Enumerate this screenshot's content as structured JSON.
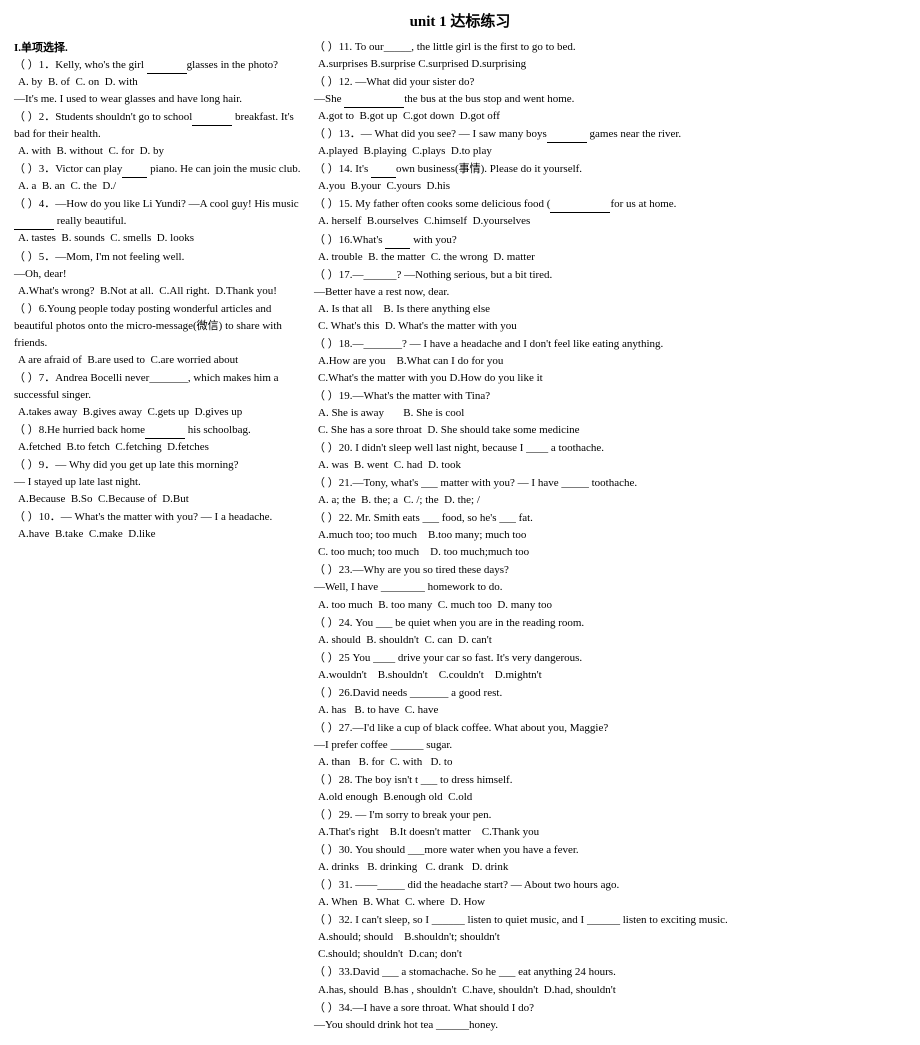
{
  "title": "unit 1  达标练习",
  "left_section": {
    "header": "I.单项选择.",
    "items": [
      {
        "id": "1",
        "question": "（  ）1．Kelly, who's the girl ____glasses in the photo?",
        "options": "A. by  B. of  C. on  D. with"
      },
      {
        "id": "1b",
        "question": "—It's me. I used to wear glasses and have long hair."
      },
      {
        "id": "2",
        "question": "（  ）2．Students shouldn't go to school____ breakfast. It's bad for their health.",
        "options": "A. with  B. without  C. for  D. by"
      },
      {
        "id": "3",
        "question": "（  ）3．Victor can play____ piano. He can join the music club.",
        "options": "A. a  B. an  C. the  D./"
      },
      {
        "id": "4",
        "question": "（  ）4．—How do you like Li Yundi?  —A cool guy! His music ______ really beautiful.",
        "options": "A. tastes  B. sounds  C. smells  D. looks"
      },
      {
        "id": "5",
        "question": "（  ）5．—Mom, I'm not feeling well.",
        "sub": "—Oh, dear!",
        "options": "A.What's wrong?  B.Not at all.  C.All right.  D.Thank you!"
      },
      {
        "id": "6",
        "question": "（  ）6.Young people today posting wonderful articles and beautiful photos onto the micro-message(微信) to share with friends.",
        "options": "A are afraid of  B.are used to  C.are worried about"
      },
      {
        "id": "7",
        "question": "（  ）7．Andrea Bocelli never_______, which makes him a successful singer.",
        "options": "A.takes away  B.gives away  C.gets up  D.gives up"
      },
      {
        "id": "8",
        "question": "（  ）8.He hurried back home______ his schoolbag.",
        "options": "A.fetched  B.to fetch  C.fetching  D.fetches"
      },
      {
        "id": "9",
        "question": "（  ）9．— Why did you get up late this morning?",
        "sub": "— I stayed up late last night.",
        "options": "A.Because  B.So  C.Because of  D.But"
      },
      {
        "id": "10",
        "question": "（  ）10．— What's the matter with you? — I a headache.",
        "options": "A.have  B.take  C.make  D.like"
      }
    ]
  },
  "right_section": {
    "items": [
      {
        "id": "11",
        "text": "（  ）11. To our_____, the little girl is the first to go to bed.",
        "options": "A.surprises B.surprise C.surprised D.surprising"
      },
      {
        "id": "12",
        "text": "（  ）12. —What did your sister do?",
        "sub": "—She _______the bus at the bus stop and went home.",
        "options": "A.got to  B.got up  C.got down  D.got off"
      },
      {
        "id": "13",
        "text": "（  ）13．— What did you see? — I saw many boys______ games near the river.",
        "options": "A.played  B.playing  C.plays  D.to play"
      },
      {
        "id": "14",
        "text": "（  ）14. It's ____own business(事情). Please do it yourself.",
        "options": "A.you  B.your  C.yours  D.his"
      },
      {
        "id": "15",
        "text": "（  ）15. My father often cooks some delicious food (______for us at home.",
        "options": "A. herself  B.ourselves  C.himself  D.yourselves"
      },
      {
        "id": "16",
        "text": "（  ）16.What's ___ with you?",
        "options": "A. trouble  B. the matter  C. the wrong  D. matter"
      },
      {
        "id": "17",
        "text": "（  ）17.—______? —Nothing serious, but a bit tired.",
        "sub": "—Better have a rest now, dear.",
        "options": "A. Is that all    B. Is there anything else\nC. What's this   D. What's the matter with you"
      },
      {
        "id": "18",
        "text": "（  ）18.—_______? — I have a headache and I don't feel like eating anything.",
        "options": "A.How are you    B.What can I do for you\nC.What's the matter with you D.How do you like it"
      },
      {
        "id": "19",
        "text": "（  ）19.—What's the matter with Tina?",
        "options": "A. She is away       B. She is cool\nC. She has a sore throat   D. She should take some medicine"
      },
      {
        "id": "20",
        "text": "（  ）20. I didn't sleep well last night, because I ____ a toothache.",
        "options": "A. was  B. went  C. had  D. took"
      },
      {
        "id": "21",
        "text": "（  ）21.—Tony, what's ___ matter with you? — I have _____ toothache.",
        "options": "A. a; the  B. the; a  C. /; the  D. the; /"
      },
      {
        "id": "22",
        "text": "（  ）22. Mr. Smith eats ___ food, so he's ___ fat.",
        "options": "A.much too; too much     B.too many; much too\nC. too much; too much     D. too much;much too"
      },
      {
        "id": "23",
        "text": "（  ）23.—Why are you so tired these days?",
        "sub": "—Well, I have ________ homework to do.",
        "options": "A. too much  B. too many  C. much too  D. many too"
      },
      {
        "id": "24",
        "text": "（  ）24. You ___ be quiet when you are in the reading room.",
        "options": "A. should  B. shouldn't  C. can  D. can't"
      },
      {
        "id": "25",
        "text": "（  ）25 You ____ drive your car so fast. It's very dangerous.",
        "options": "A.wouldn't    B.shouldn't    C.couldn't\nD.mightn't"
      },
      {
        "id": "26",
        "text": "（  ）26.David needs _______ a good rest.",
        "options": "A. has   B. to have  C. have"
      },
      {
        "id": "27",
        "text": "（  ）27.—I'd like a cup of black coffee. What about you, Maggie?",
        "sub": "—I prefer coffee ______ sugar.",
        "options": "A. than   B. for  C. with   D. to"
      },
      {
        "id": "28",
        "text": "（  ）28. The boy isn't t ___ to dress himself.",
        "options": "A.old enough  B.enough old  C.old"
      },
      {
        "id": "29",
        "text": "（  ）29. — I'm sorry to break your pen.",
        "options": "A.That's right    B.It doesn't matter\nC.Thank you"
      },
      {
        "id": "30",
        "text": "（  ）30. You should ___more water when you have a fever.",
        "options": "A. drinks   B. drinking   C. drank   D. drink"
      },
      {
        "id": "31",
        "text": "（  ）31. ——_____ did the headache start? — About two hours ago.",
        "options": "A. When  B. What  C. where  D. How"
      },
      {
        "id": "32",
        "text": "（  ）32. I can't sleep, so I ______ listen to quiet music, and I ______ listen to exciting music.",
        "options": "A.should; should    B.shouldn't; shouldn't\nC.should; shouldn't  D.can; don't"
      },
      {
        "id": "33",
        "text": "（  ）33.David ___ a stomachache. So he ___ eat anything 24 hours.",
        "options": "A.has, should   B.has ,  shouldn't  C.have,\nshouldn't  D.had, shouldn't"
      },
      {
        "id": "34",
        "text": "（  ）34.—I have a sore throat. What should I do?",
        "sub": "—You should drink hot tea ______honey."
      }
    ]
  }
}
